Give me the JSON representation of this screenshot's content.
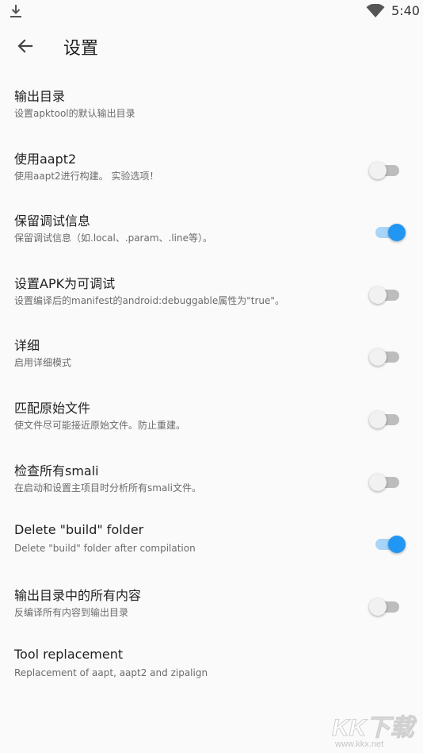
{
  "status_bar": {
    "time": "5:40"
  },
  "app_bar": {
    "title": "设置"
  },
  "settings": [
    {
      "title": "输出目录",
      "summary": "设置apktool的默认输出目录",
      "toggle": null
    },
    {
      "title": "使用aapt2",
      "summary": "使用aapt2进行构建。 实验选项！",
      "toggle": false
    },
    {
      "title": "保留调试信息",
      "summary": "保留调试信息（如.local、.param、.line等）。",
      "toggle": true
    },
    {
      "title": "设置APK为可调试",
      "summary": "设置编译后的manifest的android:debuggable属性为\"true\"。",
      "toggle": false
    },
    {
      "title": "详细",
      "summary": "启用详细模式",
      "toggle": false
    },
    {
      "title": "匹配原始文件",
      "summary": "使文件尽可能接近原始文件。防止重建。",
      "toggle": false
    },
    {
      "title": "检查所有smali",
      "summary": "在启动和设置主项目时分析所有smali文件。",
      "toggle": false
    },
    {
      "title": "Delete \"build\" folder",
      "summary": "Delete \"build\" folder after compilation",
      "toggle": true
    },
    {
      "title": "输出目录中的所有内容",
      "summary": "反编译所有内容到输出目录",
      "toggle": false
    },
    {
      "title": "Tool replacement",
      "summary": "Replacement of aapt, aapt2 and zipalign",
      "toggle": null
    }
  ],
  "watermark": {
    "text": "KK下载",
    "url": "www.kkx.net"
  },
  "colors": {
    "accent": "#2196f3",
    "accent_track": "#a8d4f7",
    "off_track": "#bdbdbd",
    "background": "#fafafa"
  },
  "icons": {
    "status_left": "download-icon",
    "status_right": "wifi-icon",
    "nav": "arrow-back-icon"
  }
}
